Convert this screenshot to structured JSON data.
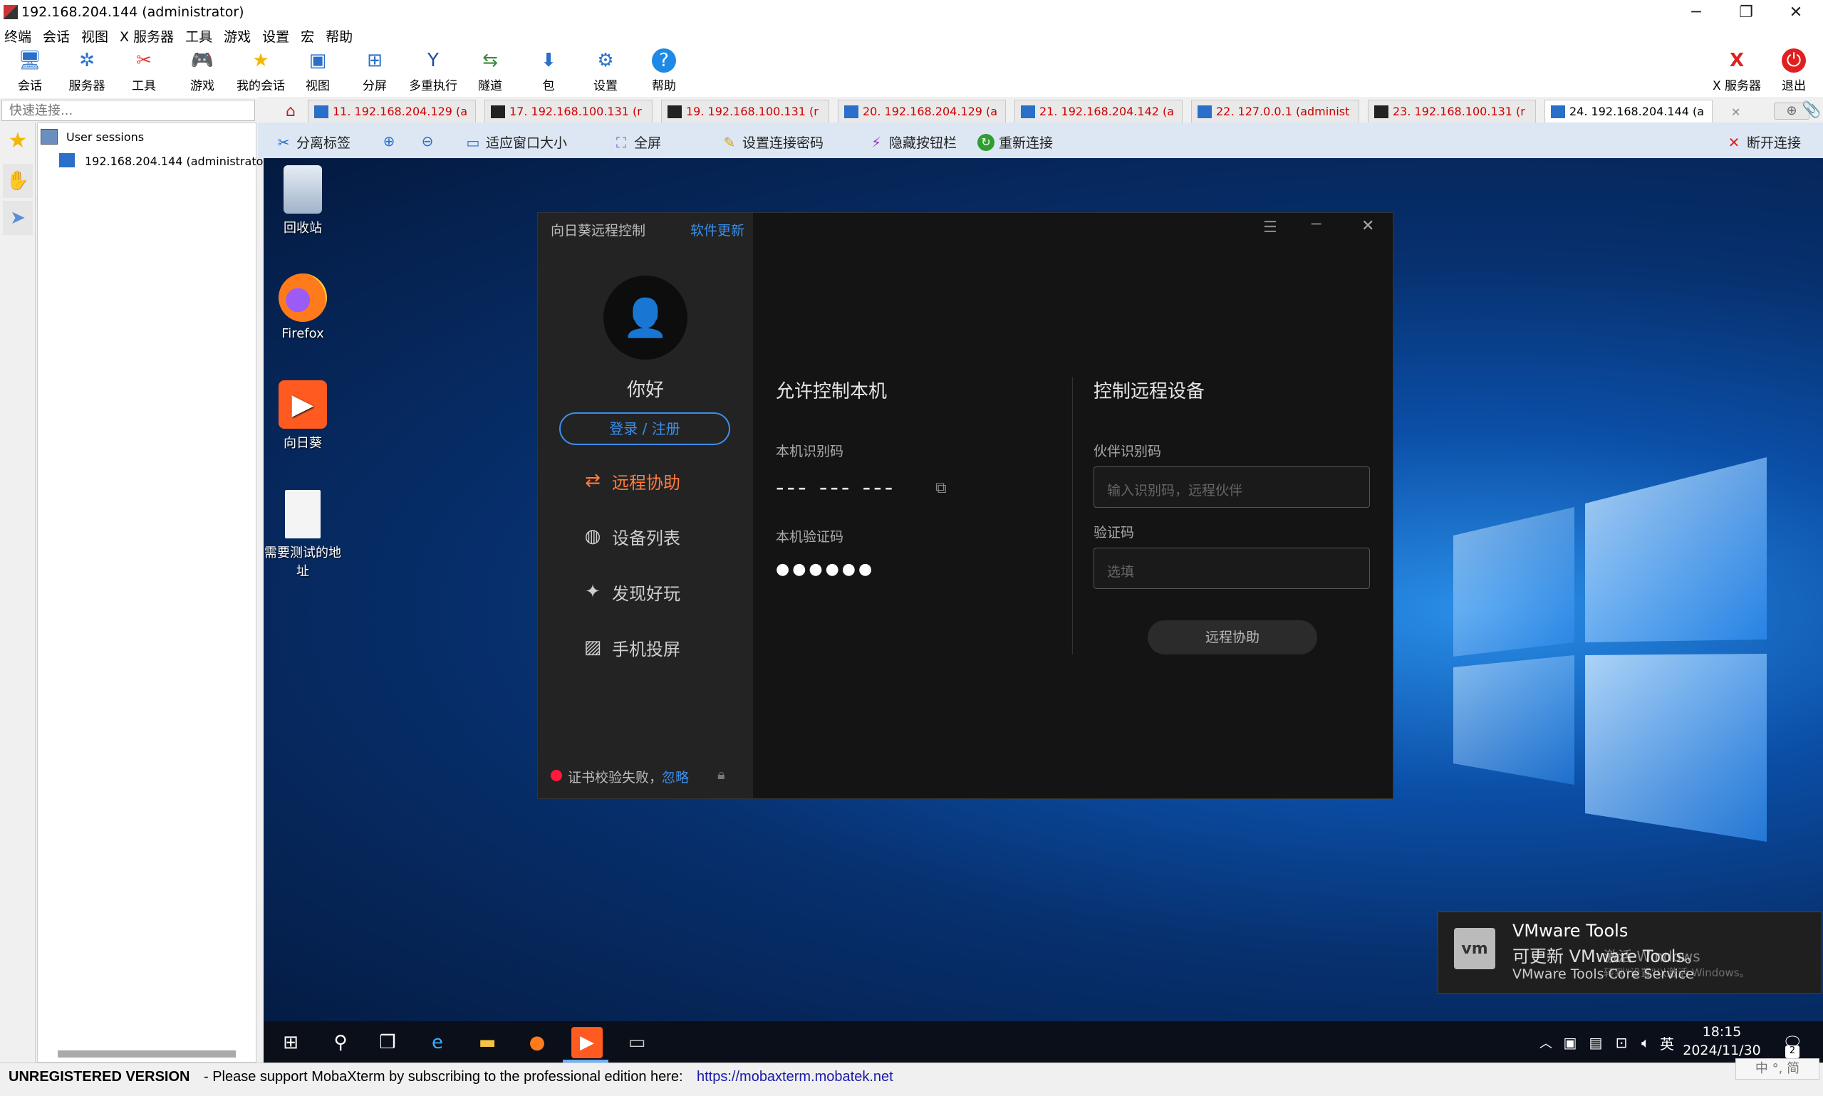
{
  "window": {
    "title": "192.168.204.144 (administrator)"
  },
  "menu": [
    "终端",
    "会话",
    "视图",
    "X 服务器",
    "工具",
    "游戏",
    "设置",
    "宏",
    "帮助"
  ],
  "toolbar": {
    "buttons": [
      {
        "label": "会话",
        "icon": "session-icon"
      },
      {
        "label": "服务器",
        "icon": "servers-icon"
      },
      {
        "label": "工具",
        "icon": "tools-icon"
      },
      {
        "label": "游戏",
        "icon": "games-icon"
      },
      {
        "label": "我的会话",
        "icon": "star-icon"
      },
      {
        "label": "视图",
        "icon": "view-icon"
      },
      {
        "label": "分屏",
        "icon": "split-icon"
      },
      {
        "label": "多重执行",
        "icon": "multiexec-icon"
      },
      {
        "label": "隧道",
        "icon": "tunnel-icon"
      },
      {
        "label": "包",
        "icon": "packages-icon"
      },
      {
        "label": "设置",
        "icon": "settings-icon"
      },
      {
        "label": "帮助",
        "icon": "help-icon"
      }
    ],
    "xserver_label": "X 服务器",
    "exit_label": "退出"
  },
  "quick_connect": {
    "placeholder": "快速连接..."
  },
  "tabs": [
    {
      "label": "11. 192.168.204.129 (a"
    },
    {
      "label": "17. 192.168.100.131 (r"
    },
    {
      "label": "19. 192.168.100.131 (r"
    },
    {
      "label": "20. 192.168.204.129 (a"
    },
    {
      "label": "21. 192.168.204.142 (a"
    },
    {
      "label": "22. 127.0.0.1 (administ"
    },
    {
      "label": "23. 192.168.100.131 (r"
    },
    {
      "label": "24. 192.168.204.144 (a"
    }
  ],
  "sessions": {
    "root": "User sessions",
    "items": [
      "192.168.204.144 (administrator)"
    ]
  },
  "session_toolbar": {
    "detach": "分离标签",
    "fit": "适应窗口大小",
    "fullscreen": "全屏",
    "set_password": "设置连接密码",
    "hide_buttons": "隐藏按钮栏",
    "reconnect": "重新连接",
    "disconnect": "断开连接"
  },
  "desktop_icons": [
    {
      "label": "回收站"
    },
    {
      "label": "Firefox"
    },
    {
      "label": "向日葵"
    },
    {
      "label": "需要测试的地址"
    }
  ],
  "sunlogin": {
    "title": "向日葵远程控制",
    "update": "软件更新",
    "greeting": "你好",
    "login": "登录 / 注册",
    "nav": [
      "远程协助",
      "设备列表",
      "发现好玩",
      "手机投屏"
    ],
    "cert_error": "证书校验失败，",
    "ignore": "忽略",
    "allow_title": "允许控制本机",
    "local_id_label": "本机识别码",
    "local_id_value": "--- --- ---",
    "local_code_label": "本机验证码",
    "local_code_value": "●●●●●●",
    "control_title": "控制远程设备",
    "partner_label": "伙伴识别码",
    "partner_placeholder": "输入识别码，远程伙伴",
    "code_label": "验证码",
    "code_placeholder": "选填",
    "connect_button": "远程协助",
    "accent": "#ff7b3d",
    "link": "#3b8eea"
  },
  "notification": {
    "title": "VMware Tools",
    "line1": "可更新 VMware Tools。",
    "line2": "VMware Tools Core Service",
    "watermark1": "激活 Windows",
    "watermark2": "转到\"设置\"以激活 Windows。"
  },
  "taskbar": {
    "time": "18:15",
    "date": "2024/11/30",
    "ime": "英",
    "ime_bar": "中 °, 简",
    "notif_count": "2"
  },
  "statusbar": {
    "unregistered": "UNREGISTERED VERSION",
    "message": "-  Please support MobaXterm by subscribing to the professional edition here:",
    "link": "https://mobaxterm.mobatek.net"
  }
}
